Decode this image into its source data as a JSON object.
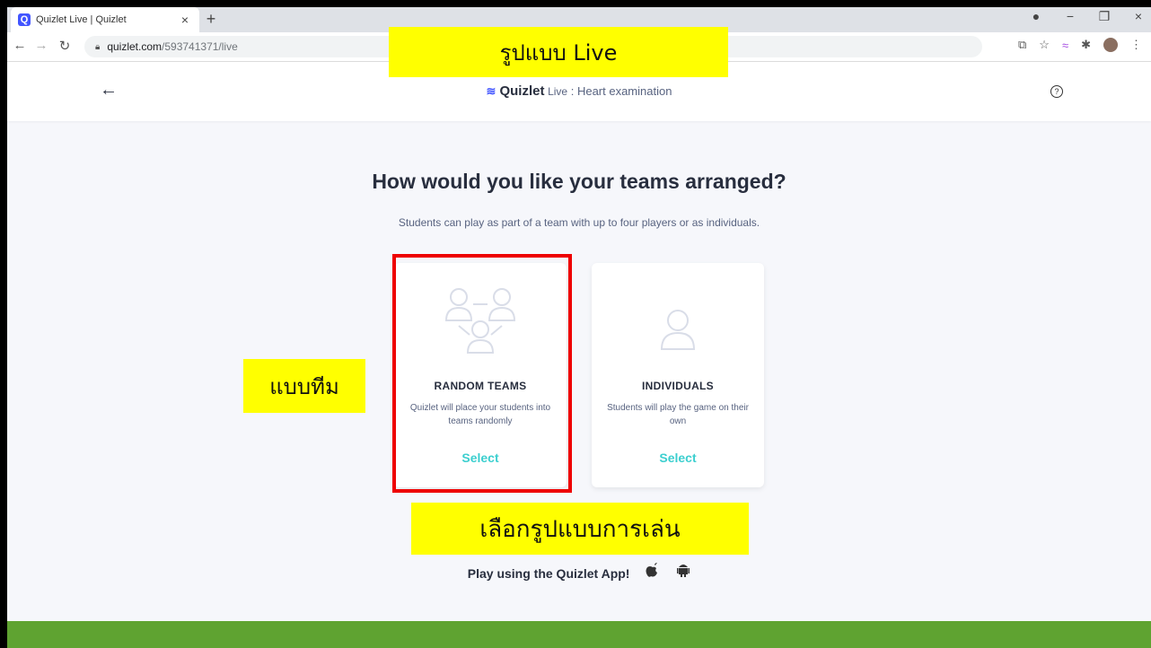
{
  "browser": {
    "tab_title": "Quizlet Live | Quizlet",
    "tab_close": "×",
    "new_tab": "+",
    "url_domain": "quizlet.com",
    "url_path": "/593741371/live",
    "window_controls": [
      "●",
      "−",
      "❐",
      "×"
    ]
  },
  "header": {
    "brand_icon": "≋",
    "brand_name": "Quizlet",
    "brand_live": "Live",
    "set_title": " : Heart examination",
    "help_icon": "?"
  },
  "main": {
    "heading": "How would you like your teams arranged?",
    "subtext": "Students can play as part of a team with up to four players or as individuals."
  },
  "cards": [
    {
      "title": "RANDOM TEAMS",
      "description": "Quizlet will place your students into teams randomly",
      "select": "Select"
    },
    {
      "title": "INDIVIDUALS",
      "description": "Students will play the game on their own",
      "select": "Select"
    }
  ],
  "promo": {
    "text": "Play using the Quizlet App!",
    "icons": [
      "apple-icon",
      "android-icon"
    ]
  },
  "annotations": {
    "live_format": "รูปแบบ Live",
    "team_mode": "แบบทีม",
    "choose_mode": "เลือกรูปแบบการเล่น"
  },
  "colors": {
    "accent": "#4255ff",
    "select": "#3ccfcf",
    "footer": "#5fa331",
    "highlight": "#ee0000",
    "annotation_bg": "#ffff00"
  }
}
